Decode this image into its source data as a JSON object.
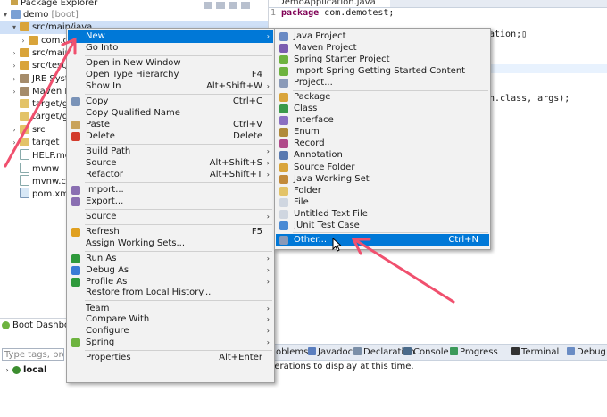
{
  "package_explorer": {
    "tab_label": "Package Explorer",
    "tree": [
      {
        "label": "demo",
        "suffix": "[boot]",
        "icon": "project-icon",
        "twisty": "▾",
        "selected": false
      },
      {
        "label": "src/main/java",
        "suffix": "",
        "icon": "package-folder-icon",
        "twisty": "▾",
        "selected": true
      },
      {
        "label": "com.c",
        "suffix": "",
        "icon": "package-icon",
        "twisty": "›",
        "selected": false
      },
      {
        "label": "src/main",
        "suffix": "",
        "icon": "package-folder-icon",
        "twisty": "›",
        "selected": false
      },
      {
        "label": "src/test/",
        "suffix": "",
        "icon": "package-folder-icon",
        "twisty": "›",
        "selected": false
      },
      {
        "label": "JRE Syste",
        "suffix": "",
        "icon": "library-icon",
        "twisty": "›",
        "selected": false
      },
      {
        "label": "Maven D",
        "suffix": "",
        "icon": "library-icon",
        "twisty": "›",
        "selected": false
      },
      {
        "label": "target/g",
        "suffix": "",
        "icon": "folder-icon",
        "twisty": "",
        "selected": false
      },
      {
        "label": "target/g",
        "suffix": "",
        "icon": "folder-icon",
        "twisty": "",
        "selected": false
      },
      {
        "label": "src",
        "suffix": "",
        "icon": "folder-icon",
        "twisty": "›",
        "selected": false
      },
      {
        "label": "target",
        "suffix": "",
        "icon": "folder-icon",
        "twisty": "›",
        "selected": false
      },
      {
        "label": "HELP.mc",
        "suffix": "",
        "icon": "file-icon",
        "twisty": "",
        "selected": false
      },
      {
        "label": "mvnw",
        "suffix": "",
        "icon": "file-icon",
        "twisty": "",
        "selected": false
      },
      {
        "label": "mvnw.cm",
        "suffix": "",
        "icon": "file-icon",
        "twisty": "",
        "selected": false
      },
      {
        "label": "pom.xml",
        "suffix": "",
        "icon": "xml-file-icon",
        "twisty": "",
        "selected": false
      }
    ]
  },
  "editor": {
    "tab_label": "DemoApplication.java",
    "lines": [
      {
        "num": "1",
        "kw": "package",
        "text": " com.demotest;"
      },
      {
        "num": "",
        "kw": "",
        "text": "ation;▯"
      },
      {
        "num": "",
        "kw": "",
        "text": "n.class, args);"
      }
    ]
  },
  "boot_dashboard": {
    "title": "Boot Dashboa",
    "filter_placeholder": "Type tags, proje",
    "local_label": "local"
  },
  "bottom_tabs": [
    {
      "label": "oblems",
      "icon": "problems-icon"
    },
    {
      "label": "Javadoc",
      "icon": "javadoc-icon"
    },
    {
      "label": "Declaration",
      "icon": "declaration-icon"
    },
    {
      "label": "Console",
      "icon": "console-icon"
    },
    {
      "label": "Progress",
      "icon": "progress-icon"
    },
    {
      "label": "Terminal",
      "icon": "terminal-icon"
    },
    {
      "label": "Debug",
      "icon": "debug-icon"
    }
  ],
  "bottom_message": "perations to display at this time.",
  "context_menu": [
    {
      "label": "New",
      "shortcut": "",
      "arrow": "›",
      "icon": "",
      "highlight": true
    },
    {
      "label": "Go Into",
      "shortcut": "",
      "arrow": "",
      "icon": "",
      "highlight": false
    },
    {
      "sep": true
    },
    {
      "label": "Open in New Window",
      "shortcut": "",
      "arrow": "",
      "icon": "",
      "highlight": false
    },
    {
      "label": "Open Type Hierarchy",
      "shortcut": "F4",
      "arrow": "",
      "icon": "",
      "highlight": false
    },
    {
      "label": "Show In",
      "shortcut": "Alt+Shift+W",
      "arrow": "›",
      "icon": "",
      "highlight": false
    },
    {
      "sep": true
    },
    {
      "label": "Copy",
      "shortcut": "Ctrl+C",
      "arrow": "",
      "icon": "copy-icon",
      "highlight": false
    },
    {
      "label": "Copy Qualified Name",
      "shortcut": "",
      "arrow": "",
      "icon": "",
      "highlight": false
    },
    {
      "label": "Paste",
      "shortcut": "Ctrl+V",
      "arrow": "",
      "icon": "paste-icon",
      "highlight": false
    },
    {
      "label": "Delete",
      "shortcut": "Delete",
      "arrow": "",
      "icon": "delete-icon",
      "highlight": false
    },
    {
      "sep": true
    },
    {
      "label": "Build Path",
      "shortcut": "",
      "arrow": "›",
      "icon": "",
      "highlight": false
    },
    {
      "label": "Source",
      "shortcut": "Alt+Shift+S",
      "arrow": "›",
      "icon": "",
      "highlight": false
    },
    {
      "label": "Refactor",
      "shortcut": "Alt+Shift+T",
      "arrow": "›",
      "icon": "",
      "highlight": false
    },
    {
      "sep": true
    },
    {
      "label": "Import...",
      "shortcut": "",
      "arrow": "",
      "icon": "import-icon",
      "highlight": false
    },
    {
      "label": "Export...",
      "shortcut": "",
      "arrow": "",
      "icon": "export-icon",
      "highlight": false
    },
    {
      "sep": true
    },
    {
      "label": "Source",
      "shortcut": "",
      "arrow": "›",
      "icon": "",
      "highlight": false
    },
    {
      "sep": true
    },
    {
      "label": "Refresh",
      "shortcut": "F5",
      "arrow": "",
      "icon": "refresh-icon",
      "highlight": false
    },
    {
      "label": "Assign Working Sets...",
      "shortcut": "",
      "arrow": "",
      "icon": "",
      "highlight": false
    },
    {
      "sep": true
    },
    {
      "label": "Run As",
      "shortcut": "",
      "arrow": "›",
      "icon": "run-icon",
      "highlight": false
    },
    {
      "label": "Debug As",
      "shortcut": "",
      "arrow": "›",
      "icon": "debug-icon",
      "highlight": false
    },
    {
      "label": "Profile As",
      "shortcut": "",
      "arrow": "›",
      "icon": "profile-icon",
      "highlight": false
    },
    {
      "label": "Restore from Local History...",
      "shortcut": "",
      "arrow": "",
      "icon": "",
      "highlight": false
    },
    {
      "sep": true
    },
    {
      "label": "Team",
      "shortcut": "",
      "arrow": "›",
      "icon": "",
      "highlight": false
    },
    {
      "label": "Compare With",
      "shortcut": "",
      "arrow": "›",
      "icon": "",
      "highlight": false
    },
    {
      "label": "Configure",
      "shortcut": "",
      "arrow": "›",
      "icon": "",
      "highlight": false
    },
    {
      "label": "Spring",
      "shortcut": "",
      "arrow": "›",
      "icon": "spring-icon",
      "highlight": false
    },
    {
      "sep": true
    },
    {
      "label": "Properties",
      "shortcut": "Alt+Enter",
      "arrow": "",
      "icon": "",
      "highlight": false
    }
  ],
  "submenu_new": [
    {
      "label": "Java Project",
      "shortcut": "",
      "icon": "java-project-icon",
      "highlight": false
    },
    {
      "label": "Maven Project",
      "shortcut": "",
      "icon": "maven-project-icon",
      "highlight": false
    },
    {
      "label": "Spring Starter Project",
      "shortcut": "",
      "icon": "spring-project-icon",
      "highlight": false
    },
    {
      "label": "Import Spring Getting Started Content",
      "shortcut": "",
      "icon": "spring-import-icon",
      "highlight": false
    },
    {
      "label": "Project...",
      "shortcut": "",
      "icon": "project-wizard-icon",
      "highlight": false
    },
    {
      "sep": true
    },
    {
      "label": "Package",
      "shortcut": "",
      "icon": "package-icon",
      "highlight": false
    },
    {
      "label": "Class",
      "shortcut": "",
      "icon": "class-icon",
      "highlight": false
    },
    {
      "label": "Interface",
      "shortcut": "",
      "icon": "interface-icon",
      "highlight": false
    },
    {
      "label": "Enum",
      "shortcut": "",
      "icon": "enum-icon",
      "highlight": false
    },
    {
      "label": "Record",
      "shortcut": "",
      "icon": "record-icon",
      "highlight": false
    },
    {
      "label": "Annotation",
      "shortcut": "",
      "icon": "annotation-icon",
      "highlight": false
    },
    {
      "label": "Source Folder",
      "shortcut": "",
      "icon": "source-folder-icon",
      "highlight": false
    },
    {
      "label": "Java Working Set",
      "shortcut": "",
      "icon": "working-set-icon",
      "highlight": false
    },
    {
      "label": "Folder",
      "shortcut": "",
      "icon": "folder-icon",
      "highlight": false
    },
    {
      "label": "File",
      "shortcut": "",
      "icon": "file-icon",
      "highlight": false
    },
    {
      "label": "Untitled Text File",
      "shortcut": "",
      "icon": "text-file-icon",
      "highlight": false
    },
    {
      "label": "JUnit Test Case",
      "shortcut": "",
      "icon": "junit-icon",
      "highlight": false
    },
    {
      "sep": true
    },
    {
      "label": "Other...",
      "shortcut": "Ctrl+N",
      "icon": "other-wizard-icon",
      "highlight": true
    }
  ],
  "colors": {
    "highlight": "#0078d7",
    "annotation_arrow": "#f0506e",
    "selection": "#cfe0f7"
  }
}
